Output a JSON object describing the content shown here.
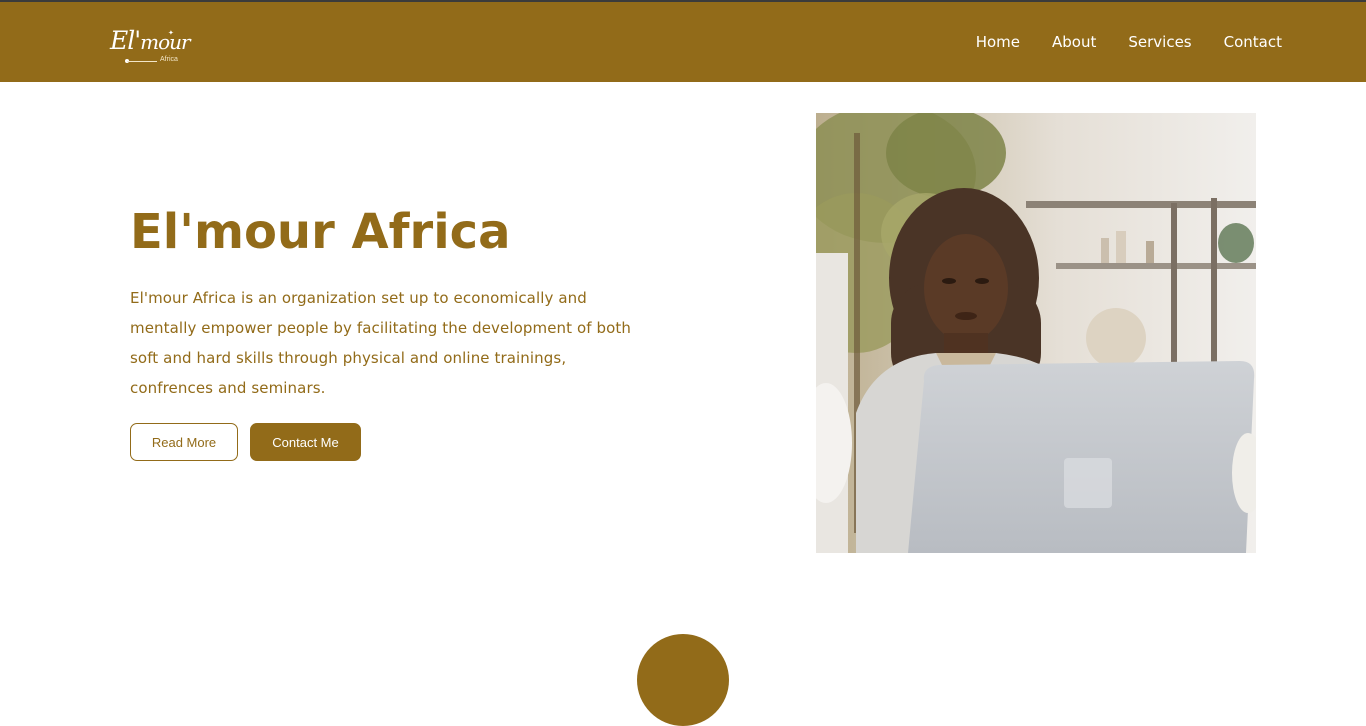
{
  "brand": {
    "logo_main": "El'",
    "logo_tail": "mour",
    "logo_sub": "Africa"
  },
  "nav": {
    "items": [
      {
        "label": "Home"
      },
      {
        "label": "About"
      },
      {
        "label": "Services"
      },
      {
        "label": "Contact"
      }
    ]
  },
  "hero": {
    "title": "El'mour Africa",
    "description": "El'mour Africa is an organization set up to economically and mentally empower people by facilitating the development of both soft and hard skills through physical and online trainings, confrences and seminars.",
    "read_more_label": "Read More",
    "contact_label": "Contact Me"
  },
  "colors": {
    "brand": "#926b19",
    "background": "#ffffff",
    "text_light": "#ffffff"
  },
  "icons": {
    "scroll_indicator": "circle-shape"
  }
}
